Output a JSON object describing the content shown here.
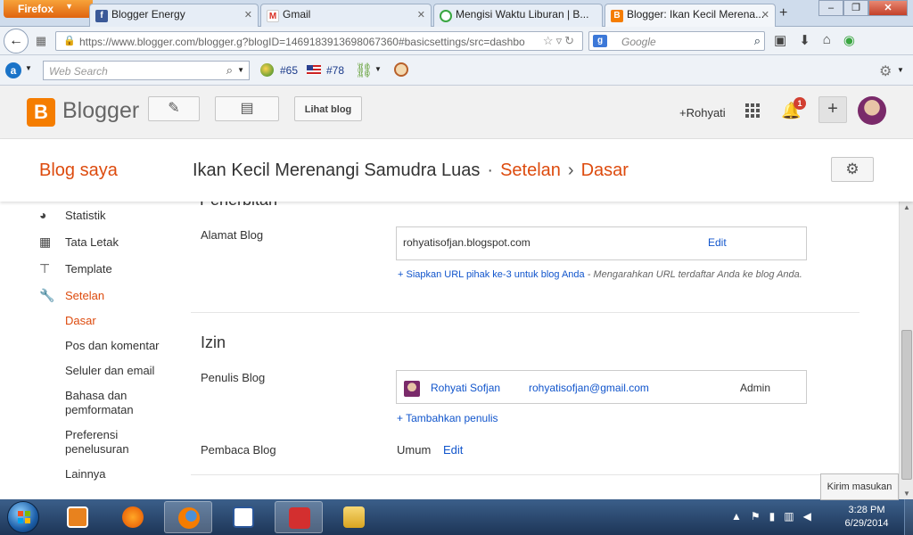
{
  "browser": {
    "menu_label": "Firefox",
    "tabs": [
      {
        "label": "Blogger Energy",
        "favicon": "facebook-icon"
      },
      {
        "label": "Gmail",
        "favicon": "gmail-icon"
      },
      {
        "label": "Mengisi Waktu Liburan | B...",
        "favicon": "loading-icon"
      },
      {
        "label": "Blogger: Ikan Kecil Merena...",
        "favicon": "blogger-icon",
        "active": true
      }
    ],
    "url_domain": "https://www.blogger.com",
    "url_rest": "/blogger.g?blogID=1469183913698067360#basicsettings/src=dashboa",
    "search_engine": "Google",
    "search_placeholder": "Google"
  },
  "ext_toolbar": {
    "web_search_placeholder": "Web Search",
    "rank1": "#65",
    "rank2": "#78"
  },
  "blogger": {
    "brand": "Blogger",
    "view_blog": "Lihat blog",
    "user": "+Rohyati",
    "notif_count": "1",
    "accent": "#dd4b0e",
    "link_color": "#1155cc"
  },
  "titlebar": {
    "my_blogs": "Blog saya",
    "blog_name": "Ikan Kecil Merenangi Samudra Luas",
    "dot": "·",
    "crumb_settings": "Setelan",
    "chevron": "›",
    "crumb_basic": "Dasar"
  },
  "sidebar": {
    "items": [
      {
        "label": "Statistik",
        "icon": "pie-chart-icon"
      },
      {
        "label": "Tata Letak",
        "icon": "layout-icon"
      },
      {
        "label": "Template",
        "icon": "paint-roller-icon"
      },
      {
        "label": "Setelan",
        "icon": "wrench-icon",
        "active": true
      }
    ],
    "subitems": [
      {
        "label": "Dasar",
        "active": true
      },
      {
        "label": "Pos dan komentar"
      },
      {
        "label": "Seluler dan email"
      },
      {
        "label": "Bahasa dan pemformatan"
      },
      {
        "label": "Preferensi penelusuran"
      },
      {
        "label": "Lainnya"
      }
    ]
  },
  "main": {
    "cut_section_title": "Penerbitan",
    "blog_address": {
      "label": "Alamat Blog",
      "value": "rohyatisofjan.blogspot.com",
      "edit": "Edit",
      "third_party_link": "+ Siapkan URL pihak ke-3 untuk blog Anda",
      "third_party_desc": " - Mengarahkan URL terdaftar Anda ke blog Anda."
    },
    "permissions": {
      "title": "Izin",
      "writers_label": "Penulis Blog",
      "writer_name": "Rohyati Sofjan",
      "writer_email": "rohyatisofjan@gmail.com",
      "writer_role": "Admin",
      "add_writer": "+ Tambahkan penulis",
      "readers_label": "Pembaca Blog",
      "readers_value": "Umum",
      "readers_edit": "Edit"
    }
  },
  "feedback": "Kirim masukan",
  "taskbar": {
    "time": "3:28 PM",
    "date": "6/29/2014"
  }
}
